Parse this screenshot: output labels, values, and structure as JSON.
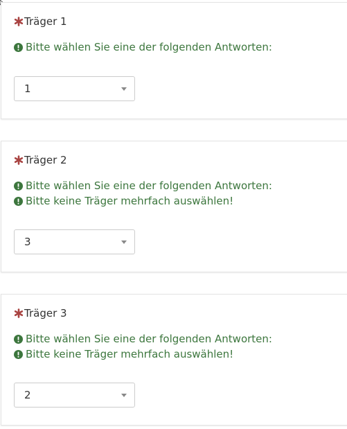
{
  "questions": [
    {
      "title": "Träger 1",
      "tips": [
        "Bitte wählen Sie eine der folgenden Antworten:"
      ],
      "selected": "1"
    },
    {
      "title": "Träger 2",
      "tips": [
        "Bitte wählen Sie eine der folgenden Antworten:",
        "Bitte keine Träger mehrfach auswählen!"
      ],
      "selected": "3"
    },
    {
      "title": "Träger 3",
      "tips": [
        "Bitte wählen Sie eine der folgenden Antworten:",
        "Bitte keine Träger mehrfach auswählen!"
      ],
      "selected": "2"
    }
  ],
  "icons": {
    "required": "asterisk-icon",
    "tip": "exclamation-circle-icon",
    "dropdown": "caret-down-icon"
  },
  "colors": {
    "required": "#a94442",
    "tip": "#3c763d",
    "text": "#333333",
    "border": "#cccccc"
  }
}
